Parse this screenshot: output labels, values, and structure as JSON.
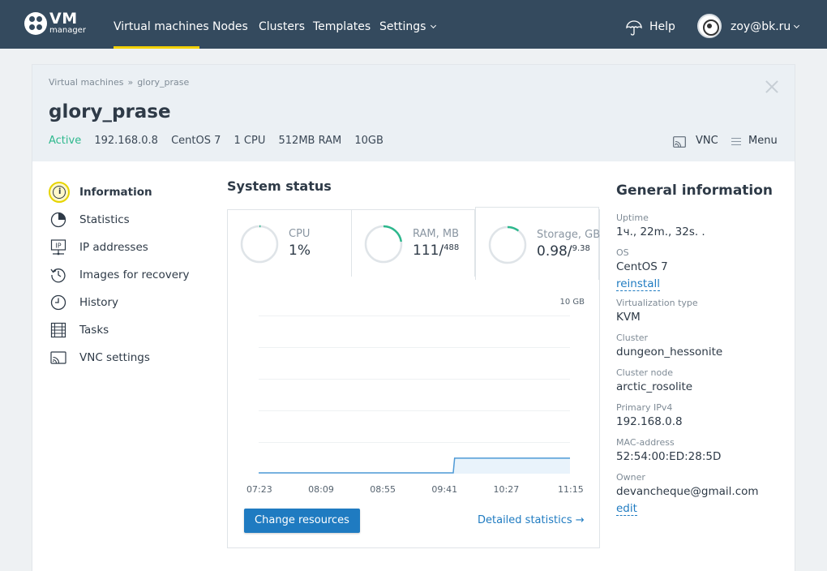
{
  "logo": {
    "brand": "VM",
    "sub": "manager"
  },
  "nav": {
    "items": [
      "Virtual machines",
      "Nodes",
      "Clusters",
      "Templates",
      "Settings"
    ],
    "help": "Help",
    "user_email": "zoy@bk.ru"
  },
  "breadcrumb": {
    "root": "Virtual machines",
    "sep": "»",
    "current": "glory_prase"
  },
  "vm": {
    "name": "glory_prase",
    "status": "Active",
    "ip": "192.168.0.8",
    "os": "CentOS 7",
    "cpu": "1 CPU",
    "ram": "512MB RAM",
    "disk": "10GB"
  },
  "header_actions": {
    "vnc": "VNC",
    "menu": "Menu"
  },
  "sidebar": [
    {
      "label": "Information",
      "icon": "info-icon",
      "active": true
    },
    {
      "label": "Statistics",
      "icon": "pie-chart-icon"
    },
    {
      "label": "IP addresses",
      "icon": "ip-icon"
    },
    {
      "label": "Images for recovery",
      "icon": "restore-icon"
    },
    {
      "label": "History",
      "icon": "clock-icon"
    },
    {
      "label": "Tasks",
      "icon": "tasks-icon"
    },
    {
      "label": "VNC settings",
      "icon": "vnc-icon"
    }
  ],
  "system_status": {
    "title": "System status",
    "gauges": [
      {
        "label": "CPU",
        "value": "1%",
        "fraction": 0.01
      },
      {
        "label": "RAM, MB",
        "value": "111/",
        "max": "488",
        "fraction": 0.227
      },
      {
        "label": "Storage, GB",
        "value": "0.98/",
        "max": "9.38",
        "fraction": 0.104
      }
    ],
    "change_button": "Change resources",
    "detailed_link": "Detailed statistics →"
  },
  "chart_data": {
    "type": "area",
    "ylabel": "",
    "ymax_label": "10 GB",
    "ylim": [
      0,
      10
    ],
    "x_labels": [
      "07:23",
      "08:09",
      "08:55",
      "09:41",
      "10:27",
      "11:15"
    ],
    "series": [
      {
        "x": [
          "07:23",
          "09:48",
          "09:49",
          "11:15"
        ],
        "values": [
          0.05,
          0.05,
          0.98,
          0.98
        ]
      }
    ]
  },
  "general_info": {
    "title": "General information",
    "uptime_label": "Uptime",
    "uptime": "1ч., 22m., 32s. .",
    "os_label": "OS",
    "os": "CentOS 7",
    "reinstall": "reinstall",
    "virt_label": "Virtualization type",
    "virt": "KVM",
    "cluster_label": "Cluster",
    "cluster": "dungeon_hessonite",
    "node_label": "Cluster node",
    "node": "arctic_rosolite",
    "ipv4_label": "Primary IPv4",
    "ipv4": "192.168.0.8",
    "mac_label": "MAC-address",
    "mac": "52:54:00:ED:28:5D",
    "owner_label": "Owner",
    "owner": "devancheque@gmail.com",
    "edit": "edit"
  },
  "colors": {
    "topbar": "#344a5e",
    "accent": "#f2d100",
    "active": "#2db88d",
    "link": "#1f7bc1",
    "gauge": "#2db88d"
  }
}
